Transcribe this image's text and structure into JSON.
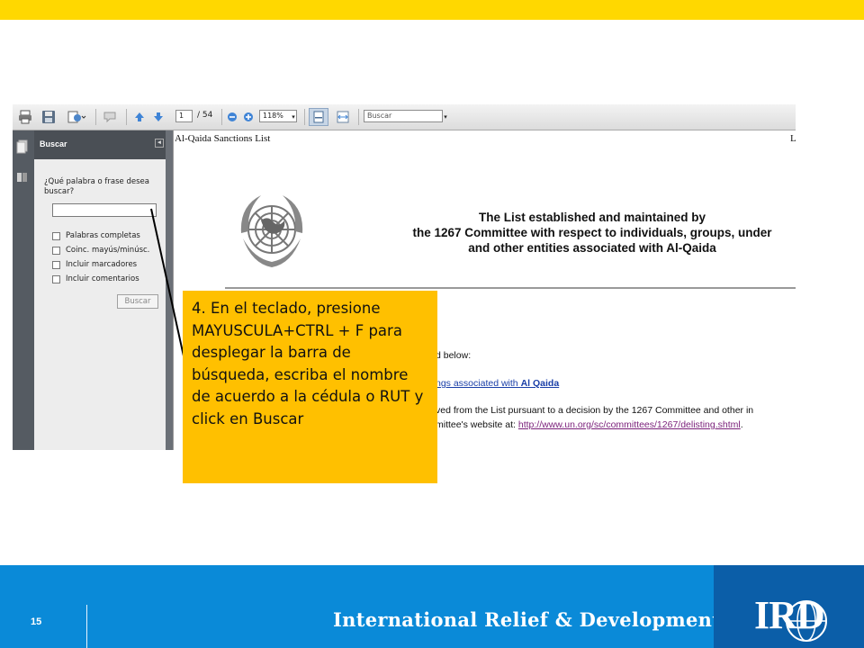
{
  "toolbar": {
    "page_current": "1",
    "page_total": "/ 54",
    "zoom": "118%",
    "search_box": "Buscar"
  },
  "search_panel": {
    "title": "Buscar",
    "question": "¿Qué palabra o frase desea buscar?",
    "options": [
      "Palabras completas",
      "Coinc. mayús/minúsc.",
      "Incluir marcadores",
      "Incluir comentarios"
    ],
    "button": "Buscar"
  },
  "document": {
    "header_left": "Al-Qaida Sanctions List",
    "header_right": "L",
    "heading_line1": "The List established and maintained by",
    "heading_line2": "the 1267 Committee with respect to individuals, groups, under",
    "heading_line3": "and other entities associated with Al-Qaida",
    "line1": "d below:",
    "line2_prefix": "ngs associated with ",
    "line2_bold": "Al Qaida",
    "line3": "ved from the List pursuant to a decision by the 1267 Committee and other in",
    "line4_prefix": "mittee's website at: ",
    "line4_link": "http://www.un.org/sc/committees/1267/delisting.shtml",
    "line4_suffix": "."
  },
  "callout": {
    "text": "4. En el teclado, presione MAYUSCULA+CTRL + F para desplegar la barra de búsqueda, escriba el nombre de acuerdo a la cédula o RUT y click en Buscar"
  },
  "footer": {
    "slide_number": "15",
    "organization": "International Relief & Development",
    "logo_text": "IRD"
  },
  "colors": {
    "top_bar": "#ffd800",
    "callout": "#ffc000",
    "footer": "#0a8ad8",
    "logo_box": "#0b5ea8"
  }
}
